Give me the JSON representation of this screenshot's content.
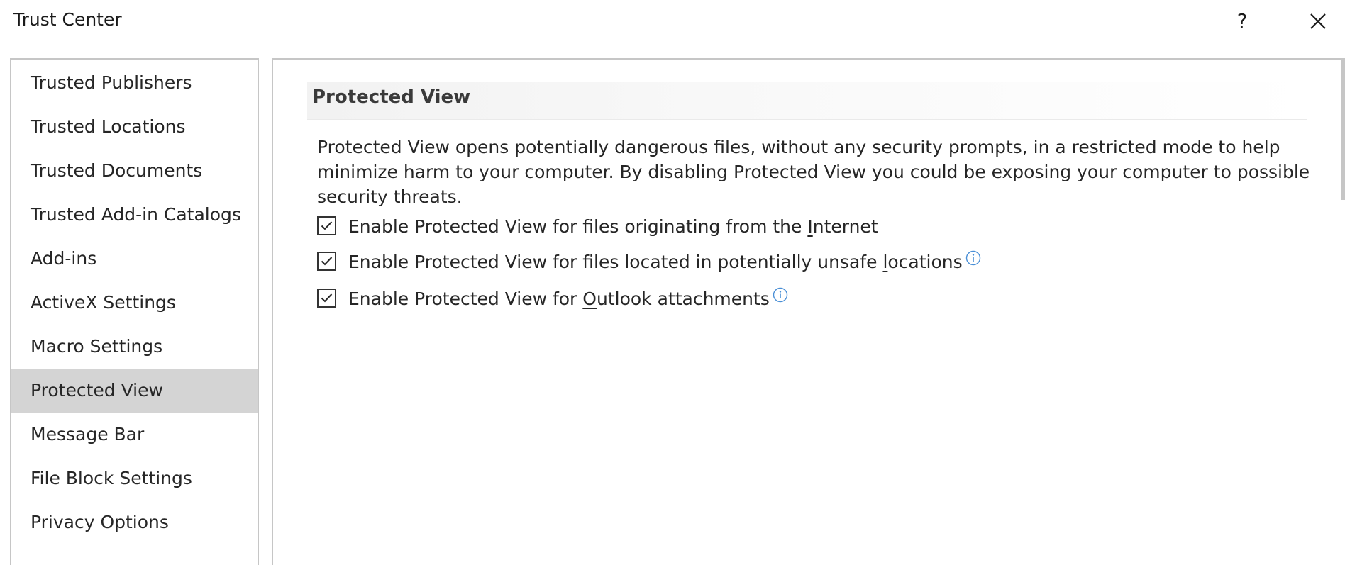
{
  "window": {
    "title": "Trust Center",
    "help_label": "?",
    "close_icon": "close-icon"
  },
  "sidebar": {
    "items": [
      {
        "label": "Trusted Publishers",
        "selected": false
      },
      {
        "label": "Trusted Locations",
        "selected": false
      },
      {
        "label": "Trusted Documents",
        "selected": false
      },
      {
        "label": "Trusted Add-in Catalogs",
        "selected": false
      },
      {
        "label": "Add-ins",
        "selected": false
      },
      {
        "label": "ActiveX Settings",
        "selected": false
      },
      {
        "label": "Macro Settings",
        "selected": false
      },
      {
        "label": "Protected View",
        "selected": true
      },
      {
        "label": "Message Bar",
        "selected": false
      },
      {
        "label": "File Block Settings",
        "selected": false
      },
      {
        "label": "Privacy Options",
        "selected": false
      }
    ]
  },
  "main": {
    "section_title": "Protected View",
    "description": "Protected View opens potentially dangerous files, without any security prompts, in a restricted mode to help minimize harm to your computer. By disabling Protected View you could be exposing your computer to possible security threats.",
    "options": [
      {
        "label_before": "Enable Protected View for files originating from the ",
        "label_underlined": "I",
        "label_after": "nternet",
        "checked": true,
        "info_icon": false
      },
      {
        "label_before": "Enable Protected View for files located in potentially unsafe ",
        "label_underlined": "l",
        "label_after": "ocations",
        "checked": true,
        "info_icon": true
      },
      {
        "label_before": "Enable Protected View for ",
        "label_underlined": "O",
        "label_after": "utlook attachments",
        "checked": true,
        "info_icon": true
      }
    ]
  },
  "colors": {
    "selected_item_bg": "#d4d4d4",
    "border": "#c6c6c6",
    "info_icon": "#4a8fd6"
  }
}
